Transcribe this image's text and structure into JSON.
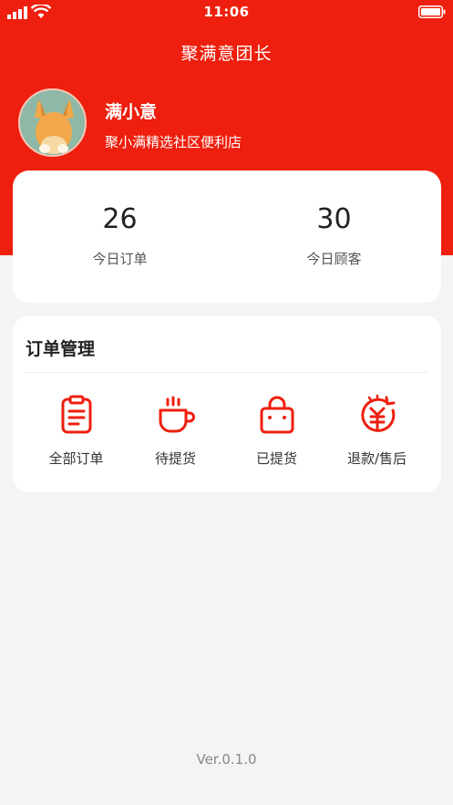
{
  "status_bar": {
    "time": "11:06"
  },
  "header": {
    "title": "聚满意团长"
  },
  "profile": {
    "name": "满小意",
    "store": "聚小满精选社区便利店"
  },
  "stats": [
    {
      "value": "26",
      "label": "今日订单"
    },
    {
      "value": "30",
      "label": "今日顾客"
    }
  ],
  "orders": {
    "title": "订单管理",
    "items": [
      {
        "label": "全部订单",
        "icon": "clipboard-icon"
      },
      {
        "label": "待提货",
        "icon": "cup-icon"
      },
      {
        "label": "已提货",
        "icon": "bag-icon"
      },
      {
        "label": "退款/售后",
        "icon": "refund-icon"
      }
    ]
  },
  "footer": {
    "version": "Ver.0.1.0"
  },
  "colors": {
    "accent": "#ee1f0e",
    "background": "#f4f4f4",
    "card": "#ffffff"
  }
}
